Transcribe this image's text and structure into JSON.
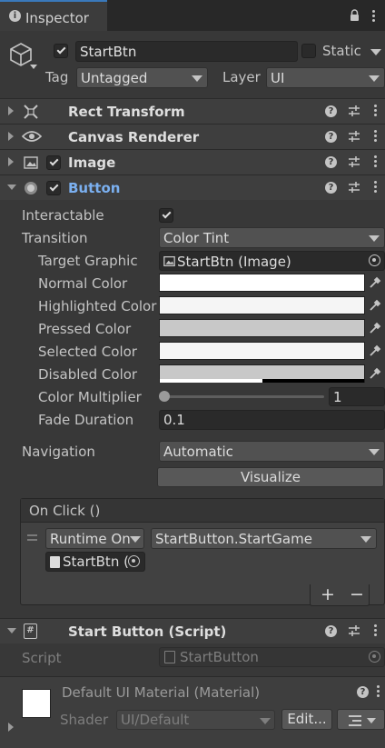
{
  "tab": {
    "title": "Inspector"
  },
  "gameobject": {
    "name": "StartBtn",
    "static_label": "Static",
    "tag_label": "Tag",
    "tag_value": "Untagged",
    "layer_label": "Layer",
    "layer_value": "UI"
  },
  "components": {
    "rect_transform": "Rect Transform",
    "canvas_renderer": "Canvas Renderer",
    "image": "Image",
    "button": "Button",
    "script_comp": "Start Button (Script)"
  },
  "button_props": {
    "interactable_label": "Interactable",
    "transition_label": "Transition",
    "transition_value": "Color Tint",
    "target_graphic_label": "Target Graphic",
    "target_graphic_value": "StartBtn (Image)",
    "normal_color_label": "Normal Color",
    "highlighted_color_label": "Highlighted Color",
    "pressed_color_label": "Pressed Color",
    "selected_color_label": "Selected Color",
    "disabled_color_label": "Disabled Color",
    "color_multiplier_label": "Color Multiplier",
    "color_multiplier_value": "1",
    "fade_duration_label": "Fade Duration",
    "fade_duration_value": "0.1",
    "navigation_label": "Navigation",
    "navigation_value": "Automatic",
    "visualize_label": "Visualize"
  },
  "colors": {
    "normal": "#ffffff",
    "highlighted": "#f5f5f5",
    "pressed": "#c8c8c8",
    "selected": "#f5f5f5",
    "disabled": "#c8c8c8",
    "accent": "#7bb0f0"
  },
  "onclick": {
    "header": "On Click ()",
    "runtime_value": "Runtime On",
    "function_value": "StartButton.StartGame",
    "object_value": "StartBtn (",
    "plus": "+",
    "minus": "−"
  },
  "script": {
    "label": "Script",
    "value": "StartButton"
  },
  "material": {
    "title": "Default UI Material (Material)",
    "shader_label": "Shader",
    "shader_value": "UI/Default",
    "edit_label": "Edit..."
  }
}
